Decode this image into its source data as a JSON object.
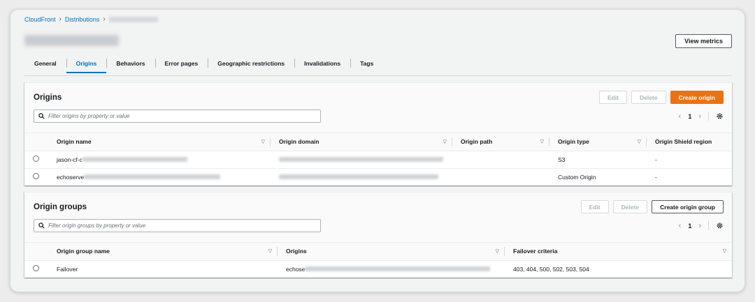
{
  "breadcrumb": {
    "root": "CloudFront",
    "section": "Distributions"
  },
  "header": {
    "view_metrics": "View metrics"
  },
  "tabs": [
    "General",
    "Origins",
    "Behaviors",
    "Error pages",
    "Geographic restrictions",
    "Invalidations",
    "Tags"
  ],
  "active_tab": "Origins",
  "origins": {
    "title": "Origins",
    "buttons": {
      "edit": "Edit",
      "delete": "Delete",
      "create": "Create origin"
    },
    "filter_placeholder": "Filter origins by property or value",
    "page": "1",
    "columns": [
      "Origin name",
      "Origin domain",
      "Origin path",
      "Origin type",
      "Origin Shield region"
    ],
    "rows": [
      {
        "name": "jason-cf-c",
        "domain": "",
        "path": "",
        "type": "S3",
        "shield": "-"
      },
      {
        "name": "echoserve",
        "domain": "",
        "path": "",
        "type": "Custom Origin",
        "shield": "-"
      }
    ]
  },
  "origin_groups": {
    "title": "Origin groups",
    "buttons": {
      "edit": "Edit",
      "delete": "Delete",
      "create": "Create origin group"
    },
    "filter_placeholder": "Filter origin groups by property or value",
    "page": "1",
    "columns": [
      "Origin group name",
      "Origins",
      "Failover criteria"
    ],
    "rows": [
      {
        "name": "Failover",
        "origins": "echose",
        "criteria": "403, 404, 500, 502, 503, 504"
      }
    ]
  },
  "colors": {
    "accent": "#0073bb",
    "primary_button": "#ec7211"
  }
}
